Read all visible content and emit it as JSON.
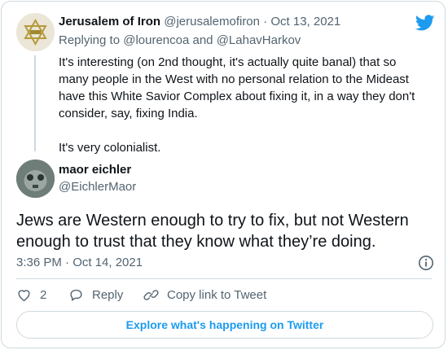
{
  "colors": {
    "twitter_blue": "#1d9bf0",
    "muted": "#536471",
    "border": "#cfd9de"
  },
  "parent_tweet": {
    "author_name": "Jerusalem of Iron",
    "author_handle": "@jerusalemofiron",
    "separator": "·",
    "date": "Oct 13, 2021",
    "replying_prefix": "Replying to",
    "replying_user1": "@lourencoa",
    "replying_and": "and",
    "replying_user2": "@LahavHarkov",
    "text_p1": "It's interesting (on 2nd thought, it's actually quite banal) that so many people in the West with no personal relation to the Mideast have this White Savior Complex about fixing it, in a way they don't consider, say, fixing India.",
    "text_p2": "It's very colonialist."
  },
  "main_tweet": {
    "author_name": "maor eichler",
    "author_handle": "@EichlerMaor",
    "text": "Jews are Western enough to try to fix, but not Western enough to trust that they know what they’re doing.",
    "timestamp": "3:36 PM · Oct 14, 2021"
  },
  "actions": {
    "like_count": "2",
    "reply_label": "Reply",
    "copy_label": "Copy link to Tweet"
  },
  "explore_label": "Explore what's happening on Twitter",
  "icons": {
    "brand": "twitter-bird-icon",
    "info": "info-icon",
    "like": "heart-icon",
    "reply": "reply-bubble-icon",
    "copy": "link-icon"
  }
}
